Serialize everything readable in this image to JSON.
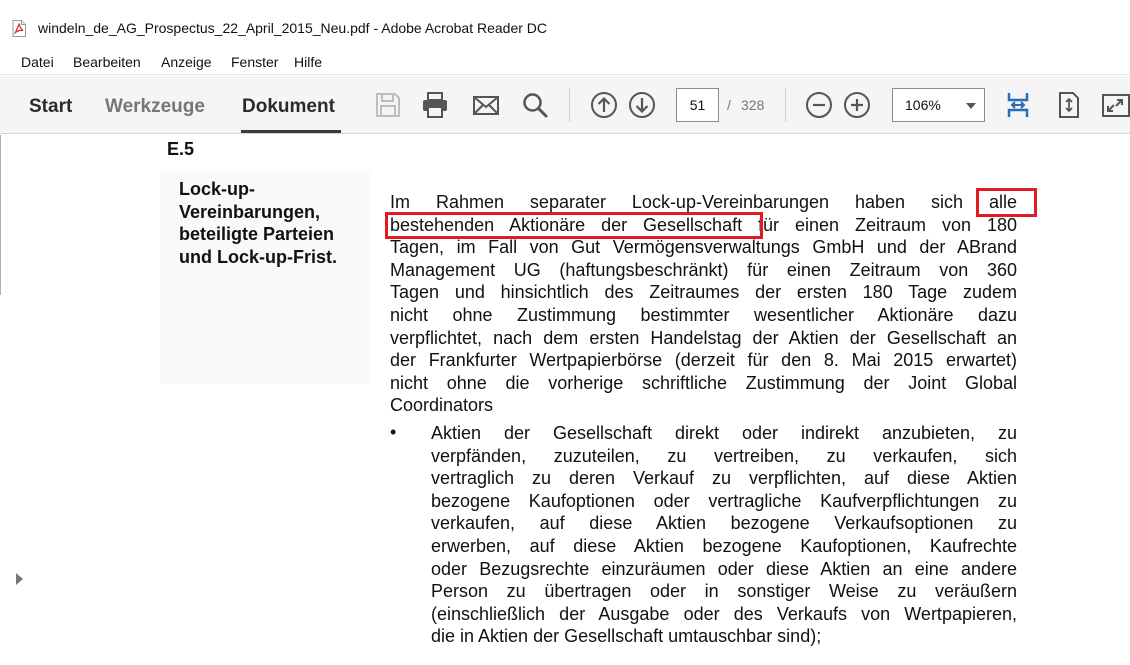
{
  "window": {
    "title": "windeln_de_AG_Prospectus_22_April_2015_Neu.pdf - Adobe Acrobat Reader DC"
  },
  "menu": [
    "Datei",
    "Bearbeiten",
    "Anzeige",
    "Fenster",
    "Hilfe"
  ],
  "tabs": {
    "start": "Start",
    "werkzeuge": "Werkzeuge",
    "dokument": "Dokument",
    "active": "Dokument"
  },
  "toolbar": {
    "icons": [
      "save-icon",
      "print-icon",
      "email-icon",
      "search-icon",
      "page-up-icon",
      "page-down-icon",
      "zoom-out-icon",
      "zoom-in-icon",
      "scroll-mode-icon",
      "fit-page-icon",
      "full-screen-icon"
    ],
    "page_current": "51",
    "page_separator": "/",
    "page_total": "328",
    "zoom": "106%"
  },
  "document": {
    "section_id": "E.5",
    "label_lines": [
      "Lock-up-",
      "Vereinbarungen,",
      "beteiligte Parteien",
      "und Lock-up-Frist."
    ],
    "paragraph_lines": [
      "Im Rahmen separater Lock-up-Vereinbarungen haben sich alle",
      "bestehenden Aktionäre der Gesellschaft für einen Zeitraum von 180",
      "Tagen, im Fall von Gut Vermögensverwaltungs GmbH und der ABrand",
      "Management UG (haftungsbeschränkt) für einen Zeitraum von 360",
      "Tagen und hinsichtlich des Zeitraumes der ersten 180 Tage zudem",
      "nicht ohne Zustimmung bestimmter wesentlicher Aktionäre dazu",
      "verpflichtet, nach dem ersten Handelstag der Aktien der Gesellschaft an",
      "der Frankfurter Wertpapierbörse (derzeit für den 8. Mai 2015 erwartet)",
      "nicht ohne die vorherige schriftliche Zustimmung der Joint Global",
      "Coordinators"
    ],
    "bullet_symbol": "•",
    "bullet_lines": [
      "Aktien der Gesellschaft direkt oder indirekt anzubieten, zu",
      "verpfänden, zuzuteilen, zu vertreiben, zu verkaufen, sich",
      "vertraglich zu deren Verkauf zu verpflichten, auf diese Aktien",
      "bezogene Kaufoptionen oder vertragliche Kaufverpflichtungen zu",
      "verkaufen, auf diese Aktien bezogene Verkaufsoptionen zu",
      "erwerben, auf diese Aktien bezogene Kaufoptionen, Kaufrechte",
      "oder Bezugsrechte einzuräumen oder diese Aktien an eine andere",
      "Person zu übertragen oder in sonstiger Weise zu veräußern",
      "(einschließlich der Ausgabe oder des Verkaufs von Wertpapieren,",
      "die in Aktien der Gesellschaft umtauschbar sind);"
    ]
  },
  "highlight": {
    "text": "alle bestehenden Aktionäre der Gesellschaft",
    "color": "#e01b24"
  },
  "colors": {
    "pdf_red": "#d9322b",
    "toolbar_bg": "#f5f5f5",
    "active_blue": "#2a6ebb"
  }
}
